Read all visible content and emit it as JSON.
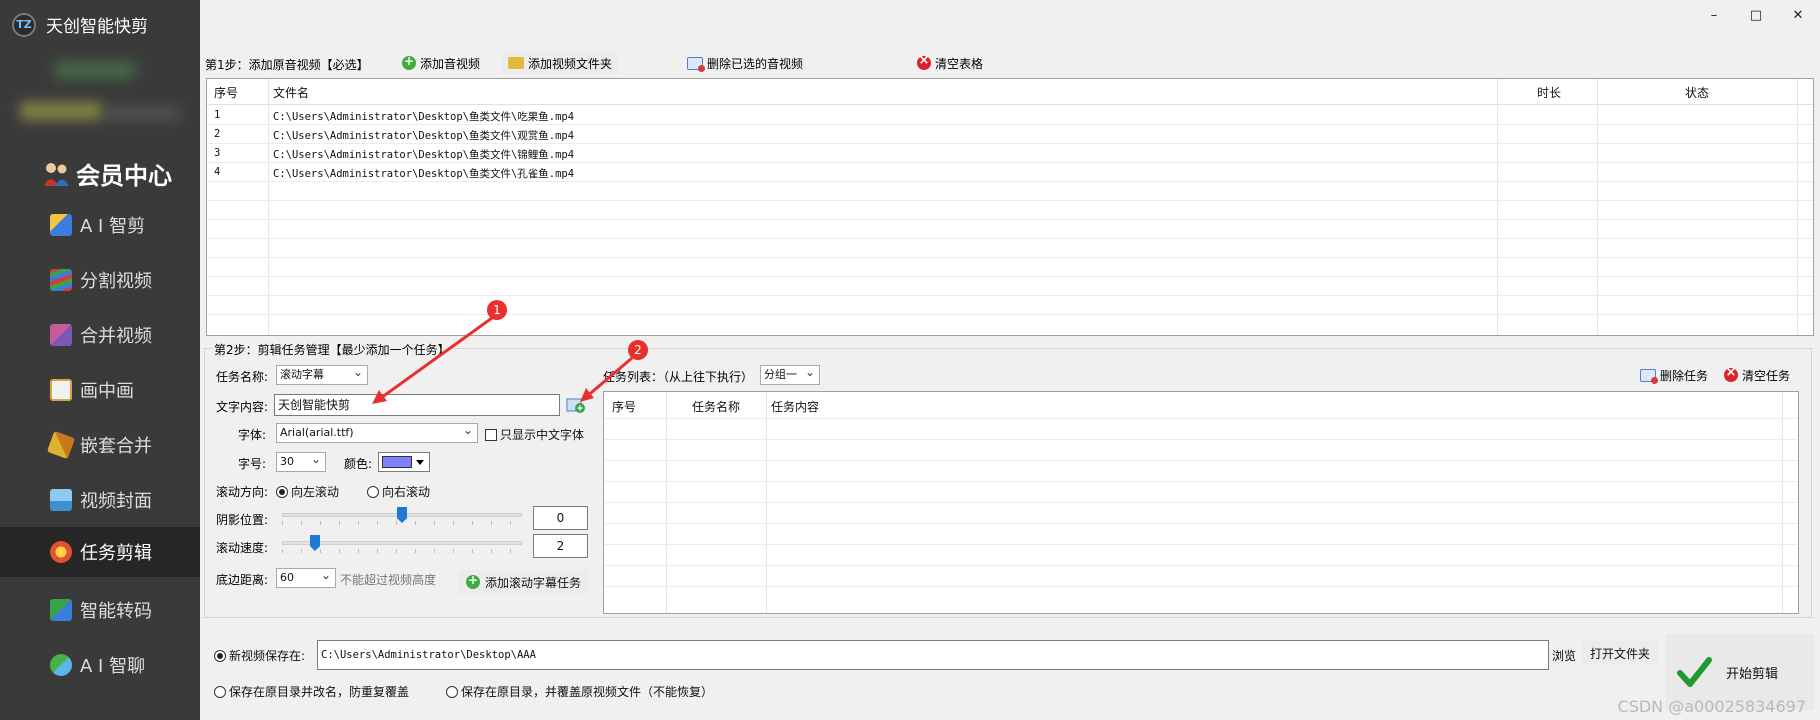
{
  "app": {
    "title": "天创智能快剪",
    "logo_text": "TZ"
  },
  "window_controls": {
    "minimize": "–",
    "maximize": "□",
    "close": "✕"
  },
  "sidebar": {
    "member_center": "会员中心",
    "items": [
      {
        "label": "A I 智剪",
        "icon": "ai-cut-icon",
        "color": "#3b7ddc"
      },
      {
        "label": "分割视频",
        "icon": "split-video-icon",
        "color": "#d83a3a"
      },
      {
        "label": "合并视频",
        "icon": "merge-video-icon",
        "color": "#c65a9a"
      },
      {
        "label": "画中画",
        "icon": "picture-in-picture-icon",
        "color": "#d9a441"
      },
      {
        "label": "嵌套合并",
        "icon": "nested-merge-icon",
        "color": "#e0b030"
      },
      {
        "label": "视频封面",
        "icon": "video-cover-icon",
        "color": "#3f8fd1"
      },
      {
        "label": "任务剪辑",
        "icon": "task-edit-icon",
        "color": "#e2522c",
        "active": true
      },
      {
        "label": "智能转码",
        "icon": "smart-transcode-icon",
        "color": "#3aa34a"
      },
      {
        "label": "A I 智聊",
        "icon": "ai-chat-icon",
        "color": "#47b04a"
      }
    ]
  },
  "step1": {
    "label": "第1步：添加原音视频【必选】",
    "add_audio_video": "添加音视频",
    "add_video_folder": "添加视频文件夹",
    "delete_selected": "删除已选的音视频",
    "clear_table": "清空表格"
  },
  "file_table": {
    "headers": {
      "index": "序号",
      "filename": "文件名",
      "duration": "时长",
      "status": "状态"
    },
    "rows": [
      {
        "index": "1",
        "filename": "C:\\Users\\Administrator\\Desktop\\鱼类文件\\吃果鱼.mp4"
      },
      {
        "index": "2",
        "filename": "C:\\Users\\Administrator\\Desktop\\鱼类文件\\观赏鱼.mp4"
      },
      {
        "index": "3",
        "filename": "C:\\Users\\Administrator\\Desktop\\鱼类文件\\锦鲤鱼.mp4"
      },
      {
        "index": "4",
        "filename": "C:\\Users\\Administrator\\Desktop\\鱼类文件\\孔雀鱼.mp4"
      }
    ]
  },
  "step2": {
    "label": "第2步：剪辑任务管理【最少添加一个任务】",
    "task_name_label": "任务名称:",
    "task_name_value": "滚动字幕",
    "text_content_label": "文字内容:",
    "text_content_value": "天创智能快剪",
    "font_label": "字体:",
    "font_value": "Arial(arial.ttf)",
    "chinese_only_label": "只显示中文字体",
    "size_label": "字号:",
    "size_value": "30",
    "color_label": "颜色:",
    "color_value": "#8080ff",
    "direction_label": "滚动方向:",
    "direction_left": "向左滚动",
    "direction_right": "向右滚动",
    "shadow_label": "阴影位置:",
    "shadow_value": "0",
    "shadow_level": 0.5,
    "speed_label": "滚动速度:",
    "speed_value": "2",
    "speed_level": 0.12,
    "bottom_label": "底边距离:",
    "bottom_value": "60",
    "bottom_hint": "不能超过视频高度",
    "add_task_button": "添加滚动字幕任务",
    "task_list_label": "任务列表：（从上往下执行）",
    "group_value": "分组一",
    "delete_task": "删除任务",
    "clear_tasks": "清空任务",
    "task_table_headers": {
      "index": "序号",
      "name": "任务名称",
      "content": "任务内容"
    }
  },
  "save": {
    "new_video_label": "新视频保存在:",
    "path": "C:\\Users\\Administrator\\Desktop\\AAA",
    "browse": "浏览",
    "open_folder": "打开文件夹",
    "option_rename": "保存在原目录并改名，防重复覆盖",
    "option_overwrite": "保存在原目录，并覆盖原视频文件（不能恢复）",
    "start_button": "开始剪辑"
  },
  "annotations": {
    "badge1": "1",
    "badge2": "2"
  },
  "watermark": "CSDN @a00025834697"
}
